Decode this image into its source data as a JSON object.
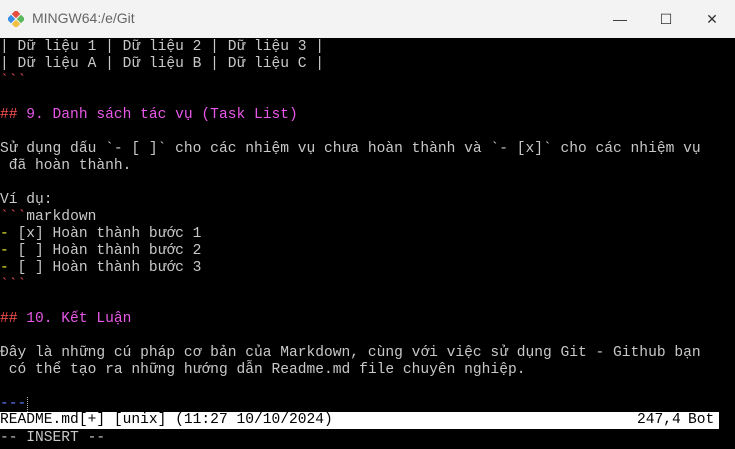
{
  "window": {
    "title": "MINGW64:/e/Git",
    "minimize": "—",
    "maximize": "☐",
    "close": "✕"
  },
  "lines": {
    "l1": "| Dữ liệu 1 | Dữ liệu 2 | Dữ liệu 3 |",
    "l2": "| Dữ liệu A | Dữ liệu B | Dữ liệu C |",
    "fence1": "```",
    "h9_hash": "##",
    "h9_text": " 9. Danh sách tác vụ (Task List)",
    "p1": "Sử dụng dấu `- [ ]` cho các nhiệm vụ chưa hoàn thành và `- [x]` cho các nhiệm vụ",
    "p2": " đã hoàn thành.",
    "ex": "Ví dụ:",
    "fence2": "```",
    "fence2_lang": "markdown",
    "dash": "-",
    "t1": " [x] Hoàn thành bước 1",
    "t2": " [ ] Hoàn thành bước 2",
    "t3": " [ ] Hoàn thành bước 3",
    "fence3": "```",
    "h10_hash": "##",
    "h10_text": " 10. Kết Luận",
    "c1": "Đây là những cú pháp cơ bản của Markdown, cùng với việc sử dụng Git - Github bạn",
    "c2": " có thể tạo ra những hướng dẫn Readme.md file chuyên nghiệp.",
    "hr": "---"
  },
  "status": {
    "file": "README.md[+] [unix] (11:27 10/10/2024)",
    "pos": "247,4",
    "scroll": "Bot"
  },
  "mode": "-- INSERT --"
}
